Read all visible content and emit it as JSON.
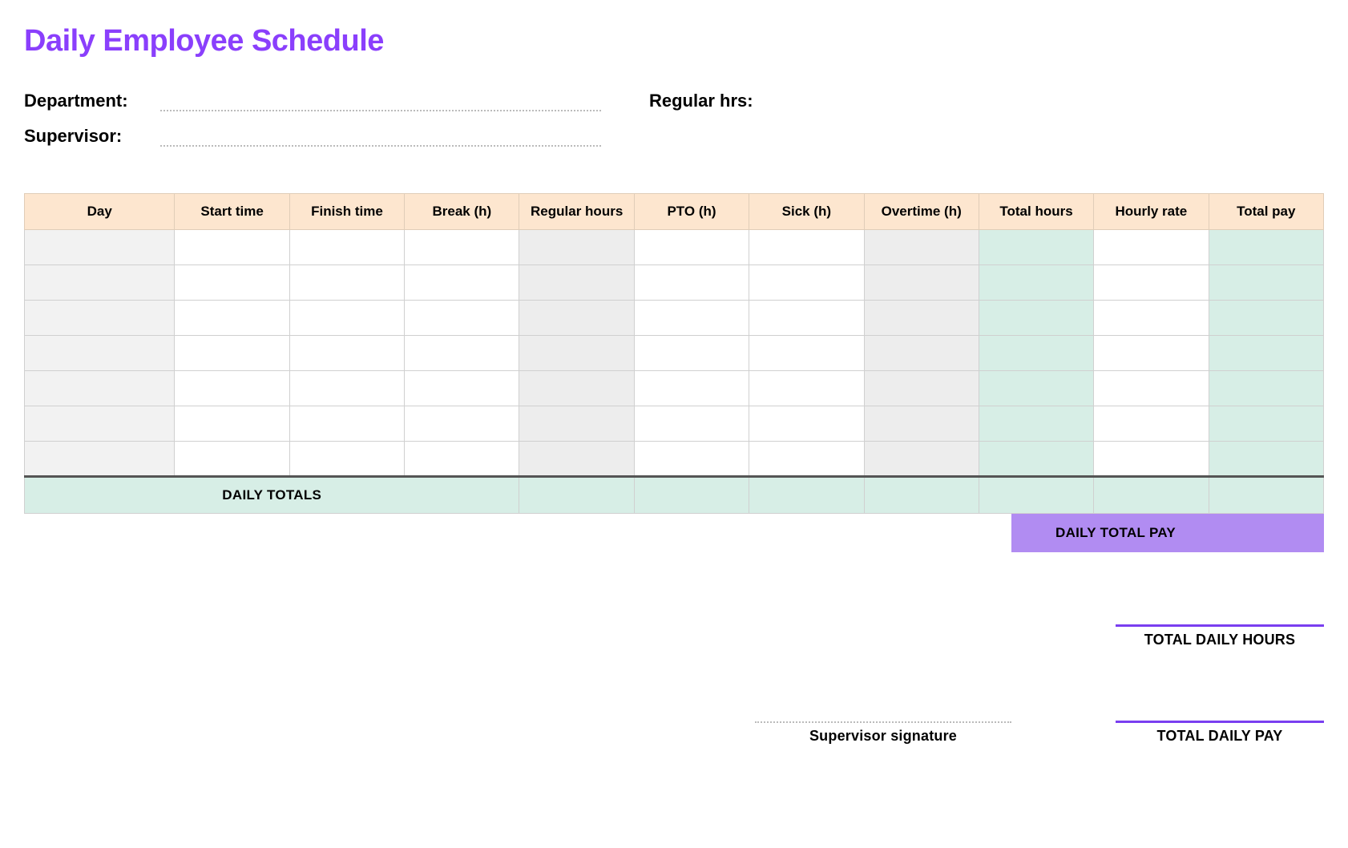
{
  "title": "Daily Employee Schedule",
  "meta": {
    "department_label": "Department:",
    "supervisor_label": "Supervisor:",
    "regular_hrs_label": "Regular hrs:",
    "department_value": "",
    "supervisor_value": "",
    "regular_hrs_value": ""
  },
  "columns": {
    "day": "Day",
    "start": "Start time",
    "finish": "Finish time",
    "break": "Break (h)",
    "regular": "Regular hours",
    "pto": "PTO (h)",
    "sick": "Sick (h)",
    "overtime": "Overtime (h)",
    "total_hours": "Total hours",
    "hourly_rate": "Hourly rate",
    "total_pay": "Total pay"
  },
  "rows": [
    {
      "day": "",
      "start": "",
      "finish": "",
      "break": "",
      "regular": "",
      "pto": "",
      "sick": "",
      "overtime": "",
      "total_hours": "",
      "hourly_rate": "",
      "total_pay": ""
    },
    {
      "day": "",
      "start": "",
      "finish": "",
      "break": "",
      "regular": "",
      "pto": "",
      "sick": "",
      "overtime": "",
      "total_hours": "",
      "hourly_rate": "",
      "total_pay": ""
    },
    {
      "day": "",
      "start": "",
      "finish": "",
      "break": "",
      "regular": "",
      "pto": "",
      "sick": "",
      "overtime": "",
      "total_hours": "",
      "hourly_rate": "",
      "total_pay": ""
    },
    {
      "day": "",
      "start": "",
      "finish": "",
      "break": "",
      "regular": "",
      "pto": "",
      "sick": "",
      "overtime": "",
      "total_hours": "",
      "hourly_rate": "",
      "total_pay": ""
    },
    {
      "day": "",
      "start": "",
      "finish": "",
      "break": "",
      "regular": "",
      "pto": "",
      "sick": "",
      "overtime": "",
      "total_hours": "",
      "hourly_rate": "",
      "total_pay": ""
    },
    {
      "day": "",
      "start": "",
      "finish": "",
      "break": "",
      "regular": "",
      "pto": "",
      "sick": "",
      "overtime": "",
      "total_hours": "",
      "hourly_rate": "",
      "total_pay": ""
    },
    {
      "day": "",
      "start": "",
      "finish": "",
      "break": "",
      "regular": "",
      "pto": "",
      "sick": "",
      "overtime": "",
      "total_hours": "",
      "hourly_rate": "",
      "total_pay": ""
    }
  ],
  "totals": {
    "label": "DAILY TOTALS",
    "regular": "",
    "pto": "",
    "sick": "",
    "overtime": "",
    "total_hours": "",
    "hourly_rate": "",
    "total_pay": ""
  },
  "daily_total_pay": {
    "label": "DAILY TOTAL PAY",
    "value": ""
  },
  "footer": {
    "signature_label": "Supervisor signature",
    "total_hours_label": "TOTAL DAILY HOURS",
    "total_pay_label": "TOTAL DAILY PAY",
    "total_hours_value": "",
    "total_pay_value": ""
  }
}
